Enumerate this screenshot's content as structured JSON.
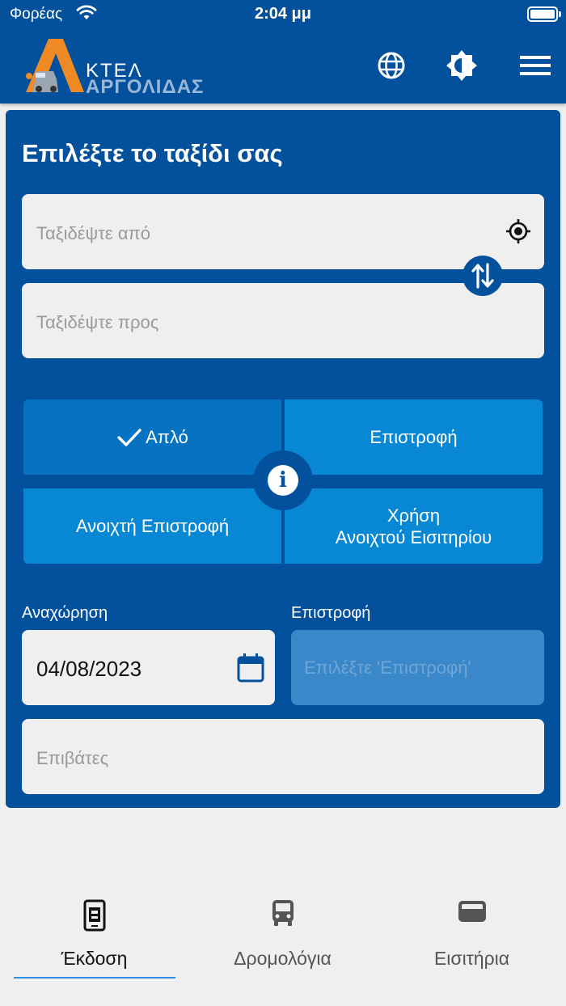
{
  "status_bar": {
    "carrier": "Φορέας",
    "time": "2:04 μμ"
  },
  "header": {
    "logo": {
      "line1": "ΚΤΕΛ",
      "line2": "ΑΡΓΟΛΙΔΑΣ"
    },
    "icons": [
      "globe-icon",
      "brightness-icon",
      "menu-icon"
    ]
  },
  "search": {
    "title": "Επιλέξτε το ταξίδι σας",
    "from_placeholder": "Ταξιδέψτε από",
    "to_placeholder": "Ταξιδέψτε προς",
    "trip_types": {
      "one_way": "Απλό",
      "return": "Επιστροφή",
      "open_return": "Ανοιχτή Επιστροφή",
      "use_open_ticket_line1": "Χρήση",
      "use_open_ticket_line2": "Ανοιχτού Εισιτηρίου"
    },
    "selected_trip_type": "one_way",
    "departure_label": "Αναχώρηση",
    "departure_value": "04/08/2023",
    "return_label": "Επιστροφή",
    "return_placeholder": "Επιλέξτε 'Επιστροφή'",
    "passengers_placeholder": "Επιβάτες"
  },
  "colors": {
    "primary": "#03519c",
    "button": "#0887d5",
    "logo_orange": "#f08a24",
    "tab_active_underline": "#2f8de4"
  },
  "tabs": [
    {
      "label": "Έκδοση",
      "icon": "phone-ticket-icon",
      "active": true
    },
    {
      "label": "Δρομολόγια",
      "icon": "bus-icon",
      "active": false
    },
    {
      "label": "Εισιτήρια",
      "icon": "wallet-icon",
      "active": false
    }
  ]
}
